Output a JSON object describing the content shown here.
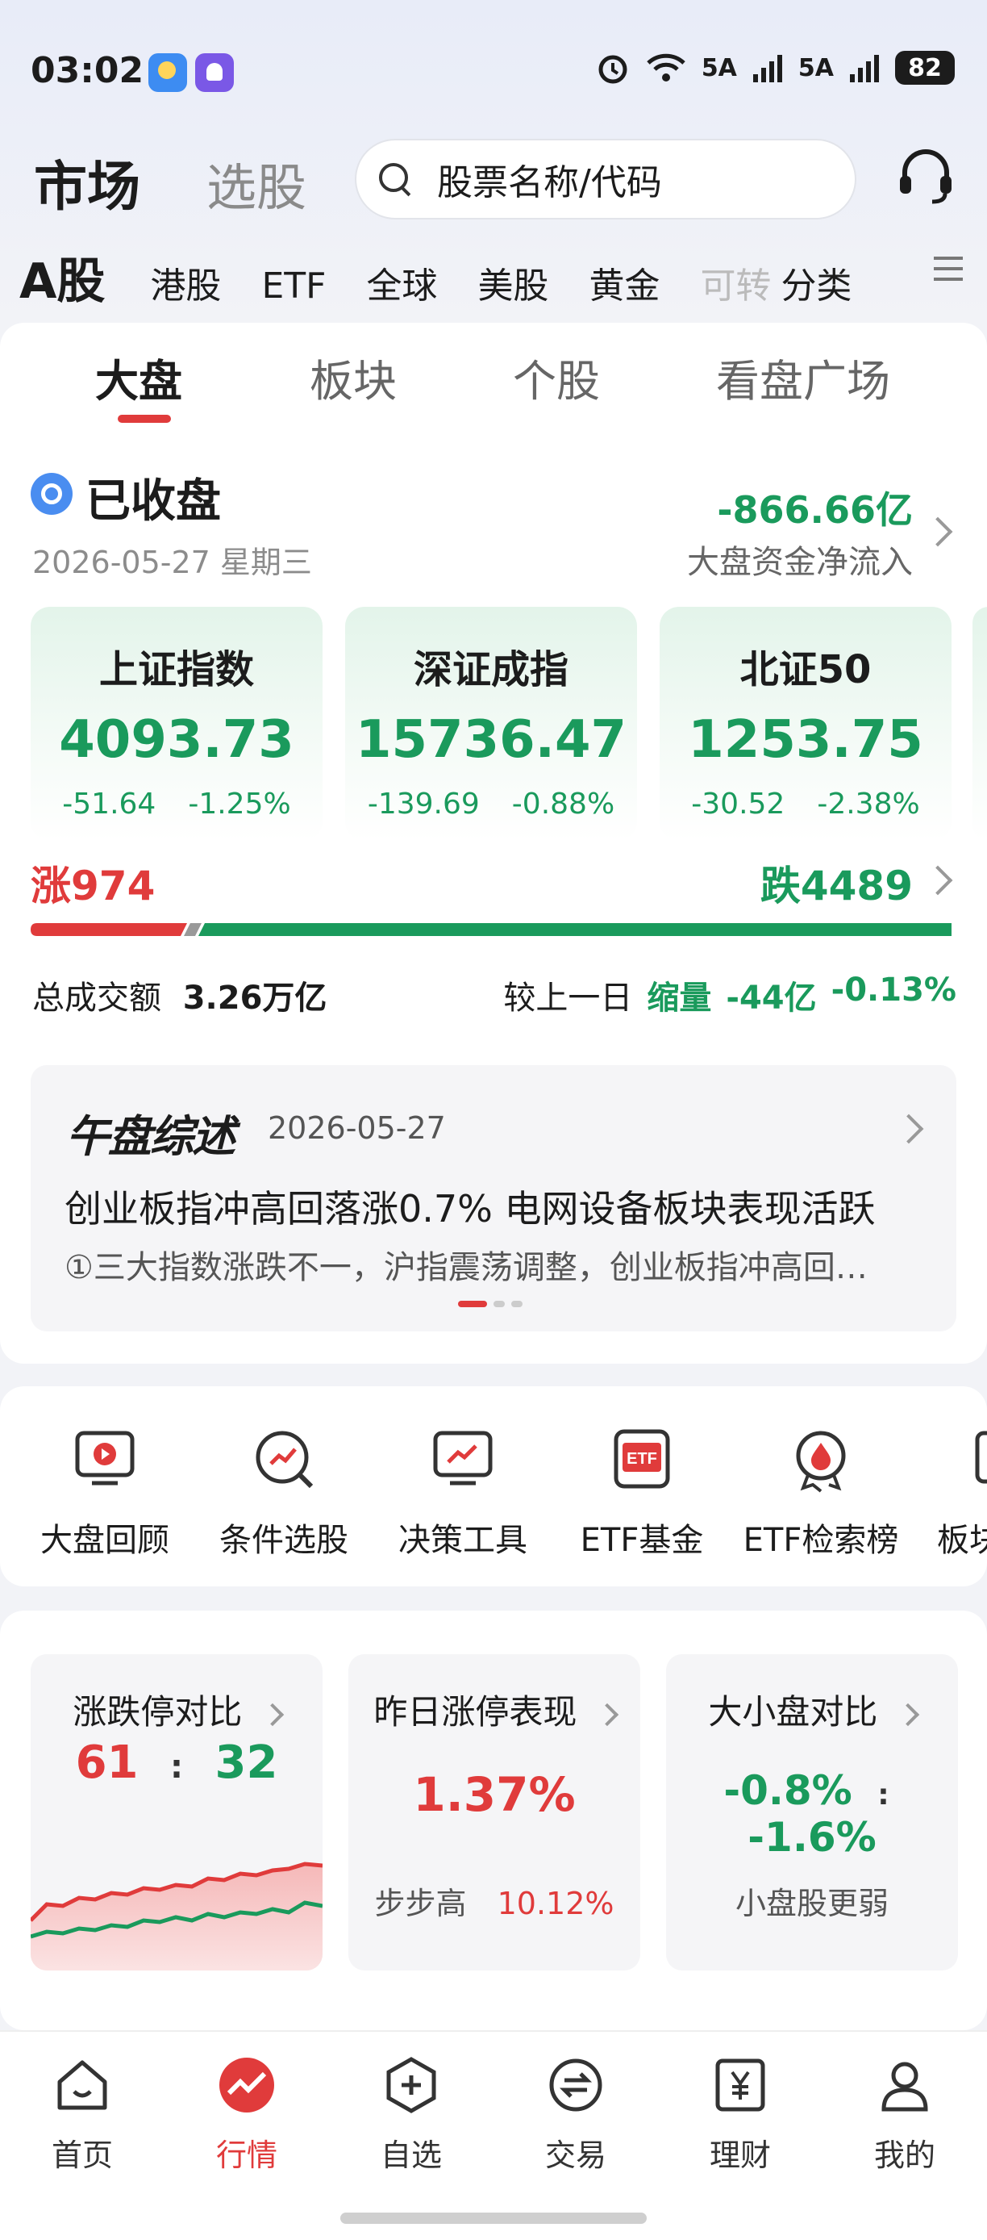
{
  "status_bar": {
    "time": "03:02",
    "signal1": "5A",
    "signal2": "5A",
    "battery": "82"
  },
  "header": {
    "title": "市场",
    "alt_tab": "选股",
    "search_placeholder": "股票名称/代码"
  },
  "market_tabs": [
    "A股",
    "港股",
    "ETF",
    "全球",
    "美股",
    "黄金",
    "可转",
    "分类"
  ],
  "sub_tabs": [
    "大盘",
    "板块",
    "个股",
    "看盘广场"
  ],
  "market_status": {
    "label": "已收盘",
    "date": "2026-05-27 星期三",
    "net_flow_value": "-866.66亿",
    "net_flow_label": "大盘资金净流入"
  },
  "indices": [
    {
      "name": "上证指数",
      "value": "4093.73",
      "change": "-51.64",
      "pct": "-1.25%"
    },
    {
      "name": "深证成指",
      "value": "15736.47",
      "change": "-139.69",
      "pct": "-0.88%"
    },
    {
      "name": "北证50",
      "value": "1253.75",
      "change": "-30.52",
      "pct": "-2.38%"
    }
  ],
  "breadth": {
    "up_label": "涨974",
    "down_label": "跌4489",
    "up_count": 974,
    "down_count": 4489
  },
  "turnover": {
    "label": "总成交额",
    "value": "3.26万亿",
    "compare_label": "较上一日",
    "compare_tag": "缩量",
    "compare_value": "-44亿",
    "compare_pct": "-0.13%"
  },
  "summary": {
    "logo": "午盘综述",
    "date": "2026-05-27",
    "title": "创业板指冲高回落涨0.7% 电网设备板块表现活跃",
    "subtitle": "①三大指数涨跌不一，沪指震荡调整，创业板指冲高回…"
  },
  "tools": [
    "大盘回顾",
    "条件选股",
    "决策工具",
    "ETF基金",
    "ETF检索榜",
    "板块"
  ],
  "stats": {
    "limit_compare": {
      "title": "涨跌停对比",
      "up": "61",
      "sep": ":",
      "down": "32"
    },
    "yesterday_limit": {
      "title": "昨日涨停表现",
      "value": "1.37%",
      "sub_label": "步步高",
      "sub_value": "10.12%"
    },
    "size_compare": {
      "title": "大小盘对比",
      "large": "-0.8%",
      "sep": ":",
      "small": "-1.6%",
      "note": "小盘股更弱"
    }
  },
  "bottom_nav": [
    "首页",
    "行情",
    "自选",
    "交易",
    "理财",
    "我的"
  ],
  "colors": {
    "up": "#e03b3b",
    "down": "#1a9a5c",
    "accent": "#e03b3b"
  }
}
